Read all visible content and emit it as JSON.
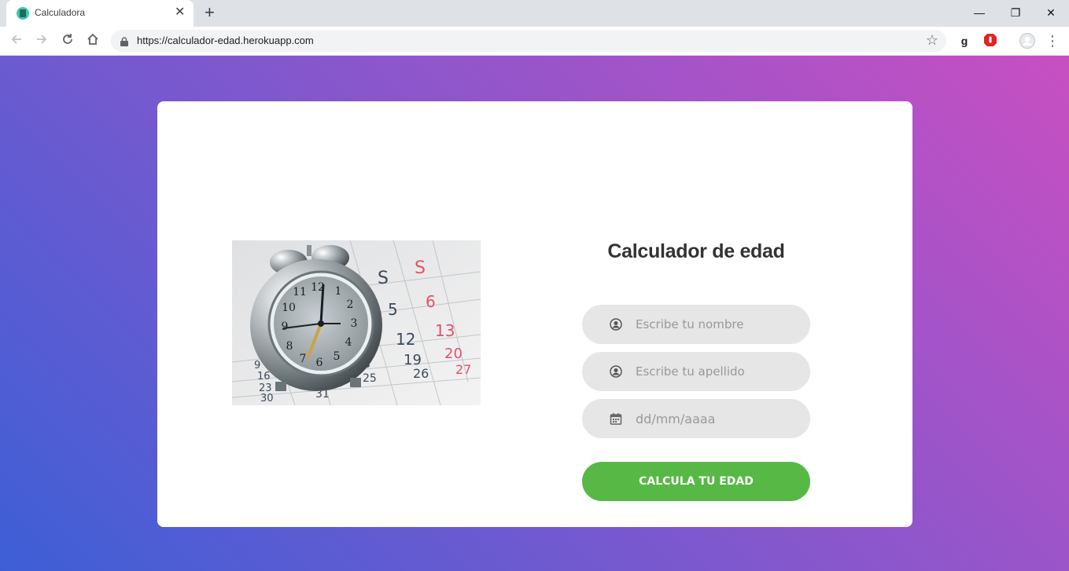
{
  "browser": {
    "tab_title": "Calculadora",
    "tab_close": "✕",
    "new_tab": "+",
    "url": "https://calculador-edad.herokuapp.com",
    "window_controls": {
      "minimize": "—",
      "restore": "❐",
      "close": "✕"
    },
    "extensions": [
      "g"
    ]
  },
  "form": {
    "title": "Calculador de edad",
    "name_placeholder": "Escribe tu nombre",
    "surname_placeholder": "Escribe tu apellido",
    "date_placeholder": "dd/mm/aaaa",
    "submit_label": "CALCULA TU EDAD"
  },
  "image": {
    "calendar_numbers": [
      "S",
      "S",
      "5",
      "6",
      "12",
      "13",
      "19",
      "20",
      "26",
      "27",
      "9",
      "16",
      "23",
      "30",
      "18",
      "25",
      "31"
    ],
    "clock_numbers": [
      "12",
      "1",
      "2",
      "3",
      "4",
      "5",
      "6",
      "7",
      "8",
      "9",
      "10",
      "11"
    ]
  },
  "colors": {
    "gradient_start": "#3d5fd6",
    "gradient_end": "#c84fc2",
    "button": "#57b846",
    "field_bg": "#e6e6e6"
  }
}
